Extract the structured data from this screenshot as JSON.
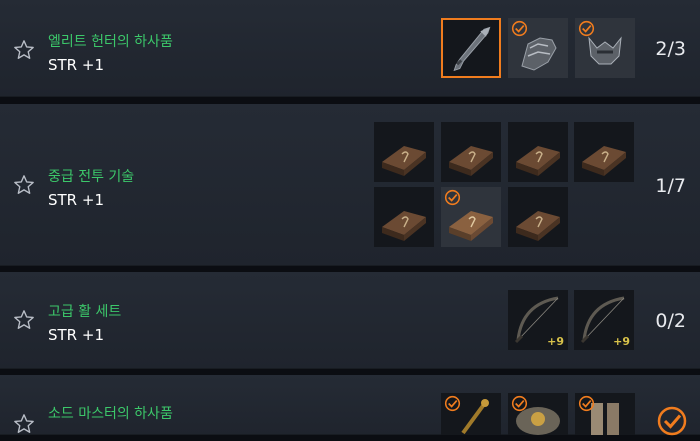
{
  "accent_color": "#f07c1e",
  "name_color": "#3cc86a",
  "collections": [
    {
      "name": "엘리트 헌터의 하사품",
      "stat": "STR +1",
      "progress": "2/3",
      "items": [
        {
          "icon": "spear-icon",
          "collected": false,
          "selected": true
        },
        {
          "icon": "gauntlet-icon",
          "collected": true
        },
        {
          "icon": "helmet-icon",
          "collected": true
        }
      ]
    },
    {
      "name": "중급 전투 기술",
      "stat": "STR +1",
      "progress": "1/7",
      "items": [
        {
          "icon": "skill-book-icon",
          "collected": false
        },
        {
          "icon": "skill-book-icon",
          "collected": false
        },
        {
          "icon": "skill-book-icon",
          "collected": false
        },
        {
          "icon": "skill-book-icon",
          "collected": false
        },
        {
          "icon": "skill-book-icon",
          "collected": false
        },
        {
          "icon": "skill-book-icon",
          "collected": true
        },
        {
          "icon": "skill-book-icon",
          "collected": false
        }
      ]
    },
    {
      "name": "고급 활 세트",
      "stat": "STR +1",
      "progress": "0/2",
      "items": [
        {
          "icon": "bow-icon",
          "collected": false,
          "enhance": "+9"
        },
        {
          "icon": "bow-icon",
          "collected": false,
          "enhance": "+9"
        }
      ]
    },
    {
      "name": "소드 마스터의 하사품",
      "stat": "",
      "progress": "",
      "complete": true,
      "items": [
        {
          "icon": "sword-icon",
          "collected": true
        },
        {
          "icon": "armor-icon",
          "collected": true
        },
        {
          "icon": "boots-icon",
          "collected": true
        }
      ]
    }
  ]
}
